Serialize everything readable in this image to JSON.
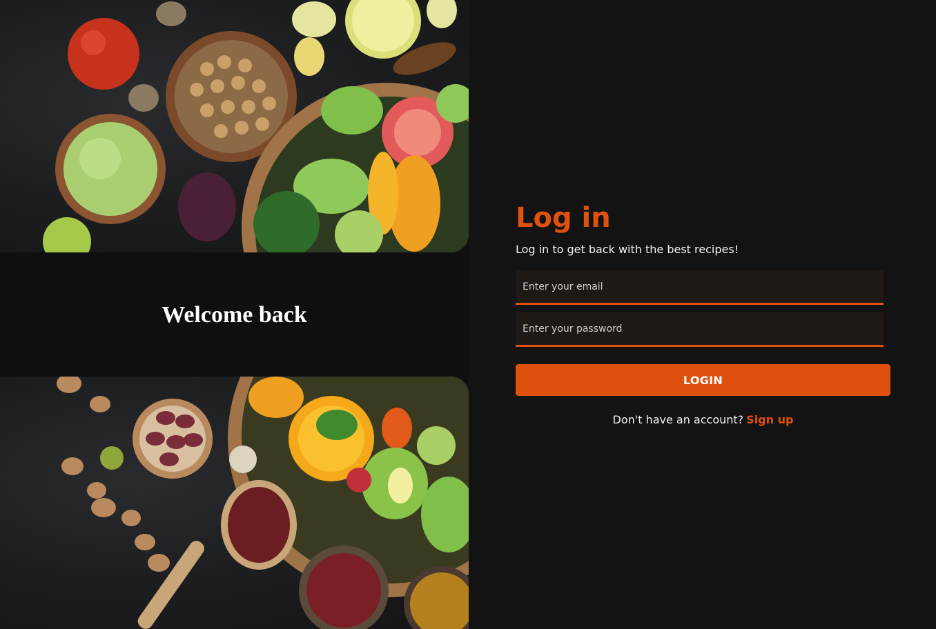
{
  "left_panel": {
    "welcome_title": "Welcome back"
  },
  "login_form": {
    "heading": "Log in",
    "subtitle": "Log in to get back with the best recipes!",
    "email_placeholder": "Enter your email",
    "password_placeholder": "Enter your password",
    "submit_label": "LOGIN",
    "signup_prompt": "Don't have an account?",
    "signup_link": "Sign up"
  },
  "colors": {
    "accent": "#e0500e",
    "background": "#131313",
    "input_background": "#1f1915",
    "text": "#f2f2f2"
  }
}
